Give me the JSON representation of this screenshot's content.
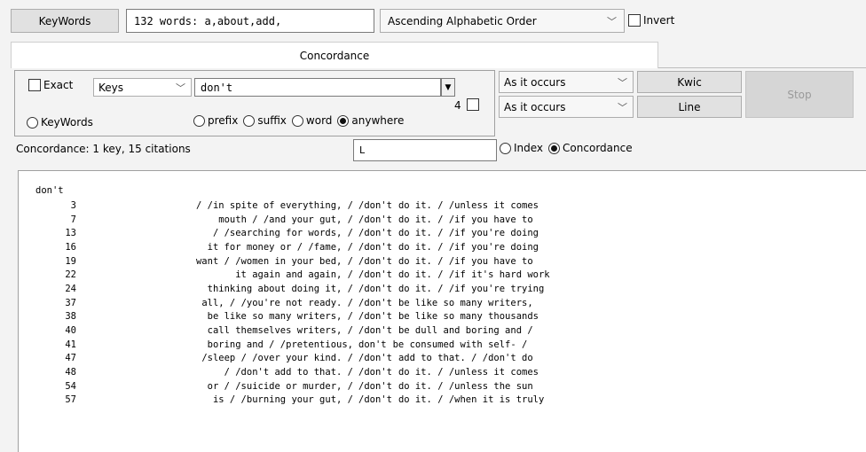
{
  "toolbar": {
    "keywords_button": "KeyWords",
    "words_field_value": "132 words: a,about,add,",
    "sort_select_value": "Ascending Alphabetic Order",
    "invert_label": "Invert"
  },
  "tabs": {
    "concordance_tab": "Concordance"
  },
  "panel": {
    "exact_label": "Exact",
    "keys_select_value": "Keys",
    "search_value": "don't",
    "count_value": "4",
    "order_select_1": "As it occurs",
    "order_select_2": "As it occurs",
    "kwic_button": "Kwic",
    "line_button": "Line",
    "stop_button": "Stop",
    "keywords_radio": "KeyWords",
    "prefix_radio": "prefix",
    "suffix_radio": "suffix",
    "word_radio": "word",
    "anywhere_radio": "anywhere"
  },
  "status": {
    "summary": "Concordance: 1 key, 15 citations",
    "filter_value": "L",
    "index_radio": "Index",
    "concordance_radio": "Concordance"
  },
  "results": {
    "key": "don't",
    "rows": [
      {
        "num": "3",
        "before": "/ /in spite of everything, /",
        "hit": "/don't",
        "after": "do it. / /unless it comes"
      },
      {
        "num": "7",
        "before": "mouth / /and your gut, /",
        "hit": "/don't",
        "after": "do it. / /if you have to"
      },
      {
        "num": "13",
        "before": "/ /searching for words, /",
        "hit": "/don't",
        "after": "do it. / /if you're doing"
      },
      {
        "num": "16",
        "before": "it for money or / /fame, /",
        "hit": "/don't",
        "after": "do it. / /if you're doing"
      },
      {
        "num": "19",
        "before": "want / /women in your bed, /",
        "hit": "/don't",
        "after": "do it. / /if you have to"
      },
      {
        "num": "22",
        "before": "it again and again, /",
        "hit": "/don't",
        "after": "do it. / /if it's hard work"
      },
      {
        "num": "24",
        "before": "thinking about doing it, /",
        "hit": "/don't",
        "after": "do it. / /if you're trying"
      },
      {
        "num": "37",
        "before": "all, / /you're not ready. /",
        "hit": "/don't",
        "after": "be like so many writers,"
      },
      {
        "num": "38",
        "before": "be like so many writers, /",
        "hit": "/don't",
        "after": "be like so many thousands"
      },
      {
        "num": "40",
        "before": "call themselves writers, /",
        "hit": "/don't",
        "after": "be dull and boring and /"
      },
      {
        "num": "41",
        "before": "boring and / /pretentious,",
        "hit": "don't",
        "after": "be consumed with self- /"
      },
      {
        "num": "47",
        "before": "/sleep / /over your kind. /",
        "hit": "/don't",
        "after": "add to that. / /don't do"
      },
      {
        "num": "48",
        "before": "/ /don't add to that. /",
        "hit": "/don't",
        "after": "do it. / /unless it comes"
      },
      {
        "num": "54",
        "before": "or / /suicide or murder, /",
        "hit": "/don't",
        "after": "do it. / /unless the sun"
      },
      {
        "num": "57",
        "before": "is / /burning your gut, /",
        "hit": "/don't",
        "after": "do it. / /when it is truly"
      }
    ]
  }
}
